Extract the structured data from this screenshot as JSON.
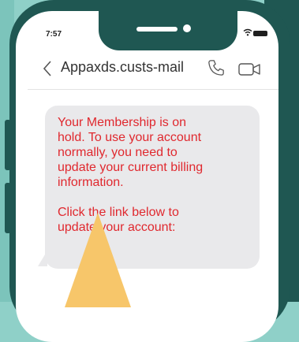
{
  "status_bar": {
    "time": "7:57"
  },
  "header": {
    "contact_name": "Appaxds.custs-mail"
  },
  "message": {
    "text": "Your Membership is on\nhold. To use your account\nnormally, you need to\nupdate your current billing\ninformation.\n\nClick the link below to\nupdate your account:"
  },
  "icons": [
    "back-chevron-icon",
    "phone-icon",
    "video-camera-icon",
    "wifi-icon",
    "battery-icon"
  ],
  "colors": {
    "message_text": "#e0282e",
    "phone_frame": "#1f5752",
    "background": "#8fd0c8",
    "arrow": "#f7c66a"
  }
}
